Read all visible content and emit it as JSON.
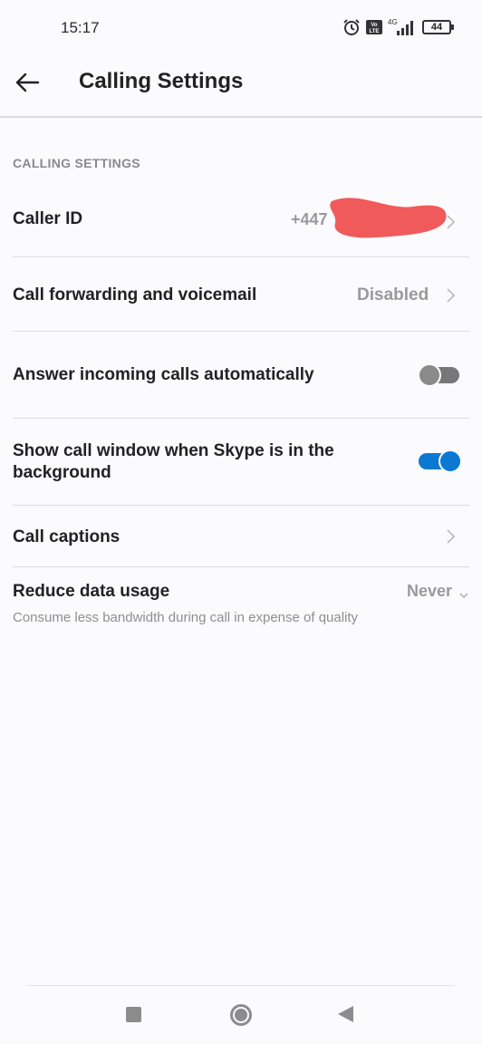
{
  "status_bar": {
    "time": "15:17",
    "network": "4G",
    "volte_label": "Vo LTE",
    "battery": "44"
  },
  "header": {
    "title": "Calling Settings"
  },
  "section": {
    "title": "CALLING SETTINGS"
  },
  "rows": {
    "caller_id": {
      "label": "Caller ID",
      "value": "+447"
    },
    "call_forwarding": {
      "label": "Call forwarding and voicemail",
      "value": "Disabled"
    },
    "answer_auto": {
      "label": "Answer incoming calls automatically",
      "enabled": false
    },
    "show_window": {
      "label": "Show call window when Skype is in the background",
      "enabled": true
    },
    "call_captions": {
      "label": "Call captions"
    },
    "reduce_data": {
      "label": "Reduce data usage",
      "value": "Never",
      "description": "Consume less bandwidth during call in expense of quality"
    }
  },
  "colors": {
    "accent": "#0b78d1",
    "redaction": "#f05a5a"
  }
}
